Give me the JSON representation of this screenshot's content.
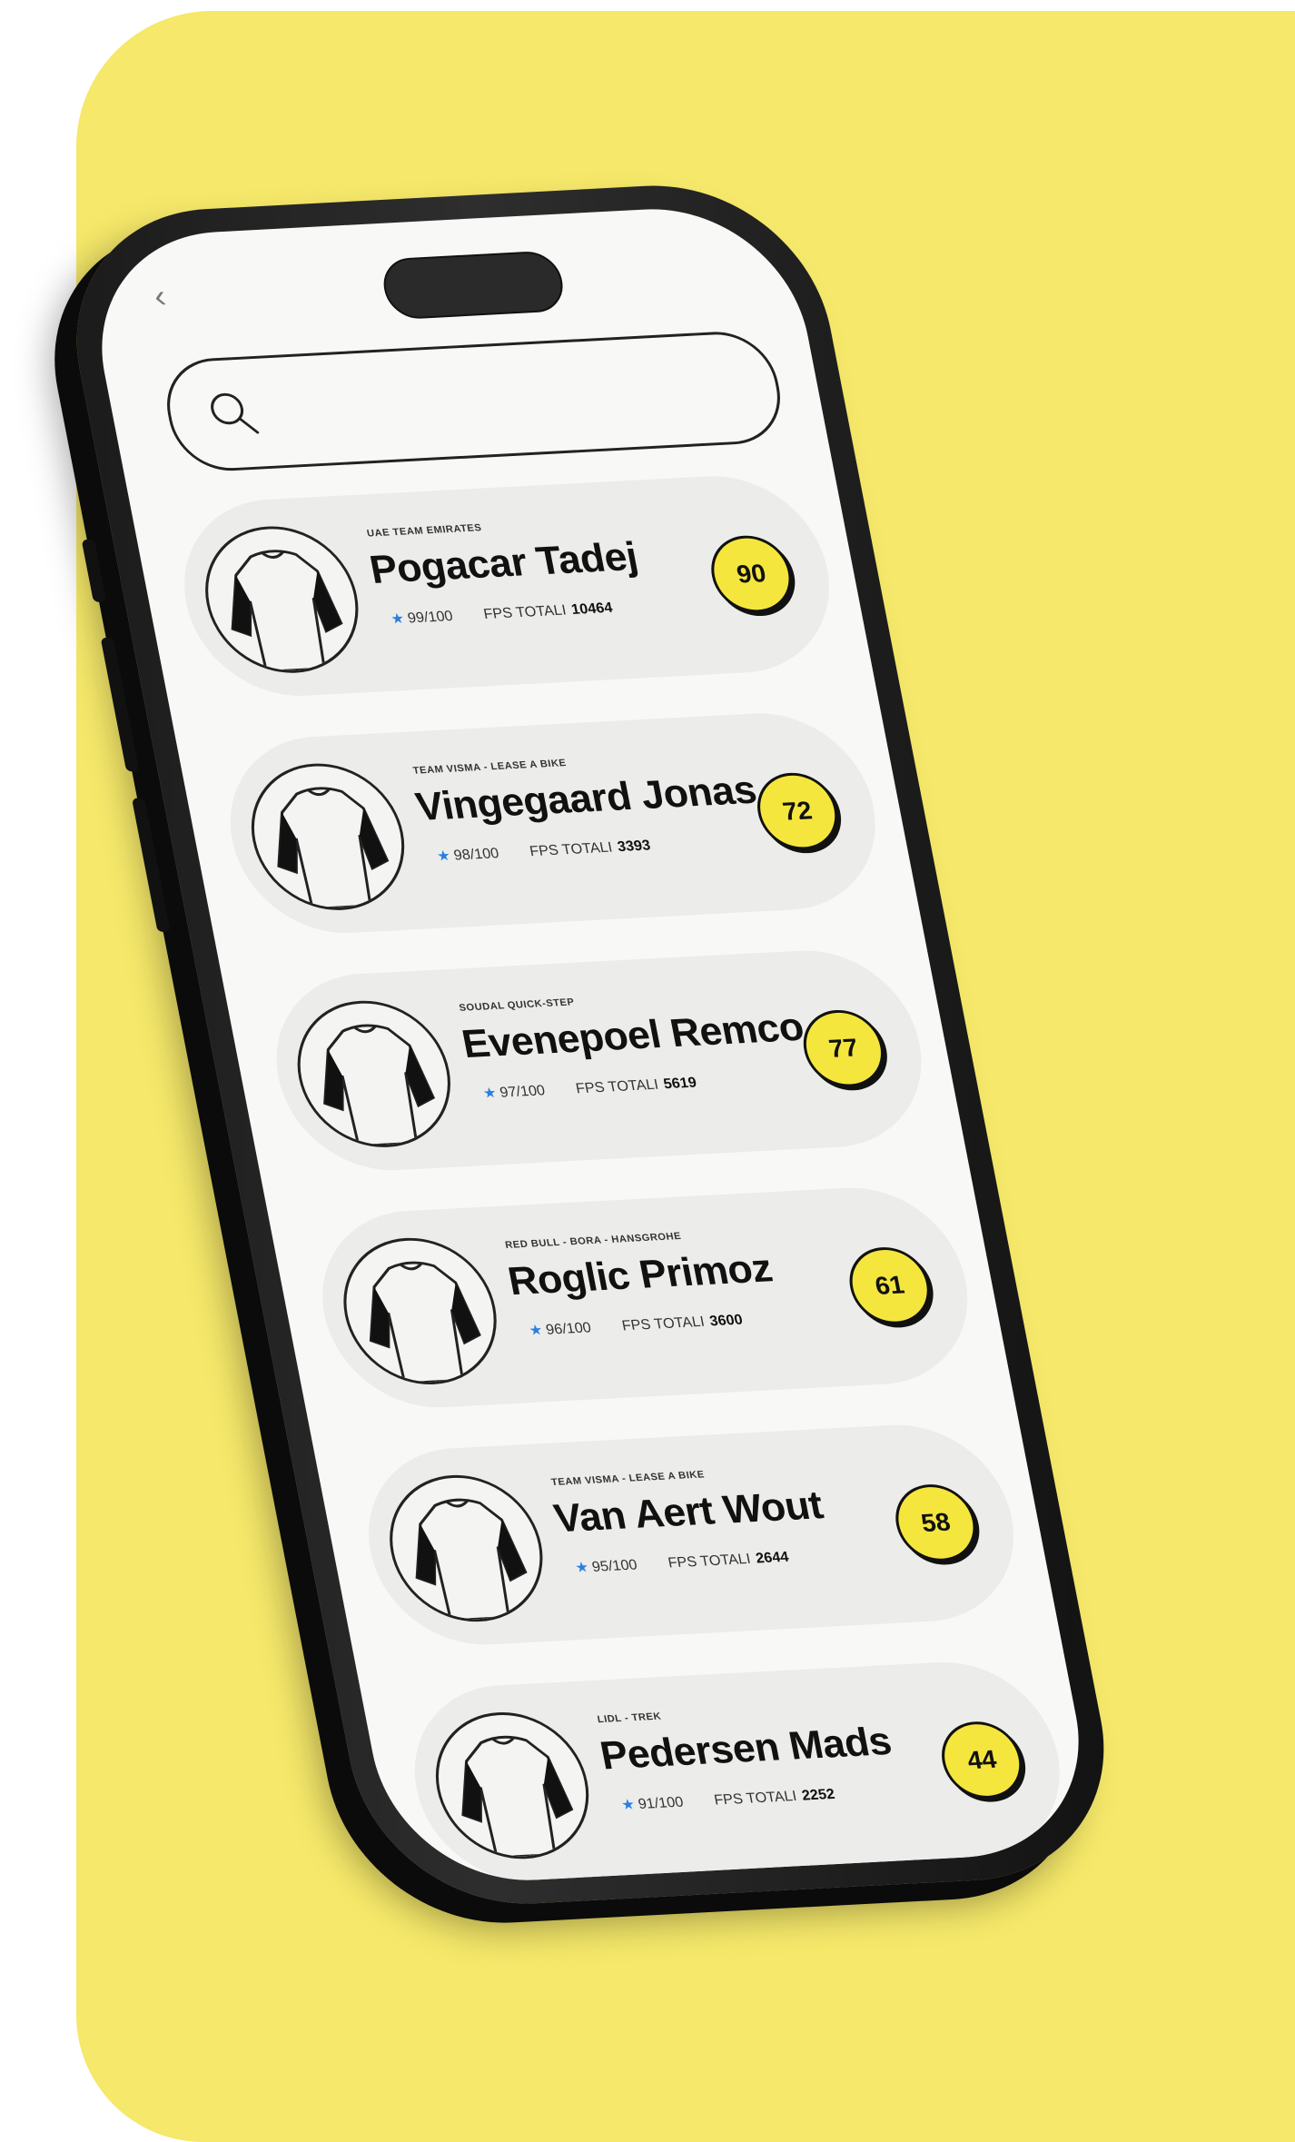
{
  "search": {
    "placeholder": ""
  },
  "riders": [
    {
      "team": "UAE TEAM EMIRATES",
      "name": "Pogacar Tadej",
      "rating": "99/100",
      "fps_label": "FPS TOTALI",
      "fps": "10464",
      "score": "90"
    },
    {
      "team": "TEAM VISMA - LEASE A BIKE",
      "name": "Vingegaard Jonas",
      "rating": "98/100",
      "fps_label": "FPS TOTALI",
      "fps": "3393",
      "score": "72"
    },
    {
      "team": "SOUDAL QUICK-STEP",
      "name": "Evenepoel Remco",
      "rating": "97/100",
      "fps_label": "FPS TOTALI",
      "fps": "5619",
      "score": "77"
    },
    {
      "team": "RED BULL - BORA - HANSGROHE",
      "name": "Roglic Primoz",
      "rating": "96/100",
      "fps_label": "FPS TOTALI",
      "fps": "3600",
      "score": "61"
    },
    {
      "team": "TEAM VISMA - LEASE A BIKE",
      "name": "Van Aert Wout",
      "rating": "95/100",
      "fps_label": "FPS TOTALI",
      "fps": "2644",
      "score": "58"
    },
    {
      "team": "LIDL - TREK",
      "name": "Pedersen Mads",
      "rating": "91/100",
      "fps_label": "FPS TOTALI",
      "fps": "2252",
      "score": "44"
    }
  ],
  "colors": {
    "background": "#f5e86a",
    "accent": "#f5e63e",
    "star": "#2a7fe0"
  },
  "icons": {
    "back": "chevron-left-icon",
    "search": "search-icon",
    "avatar": "jersey-icon",
    "star": "star-icon"
  }
}
